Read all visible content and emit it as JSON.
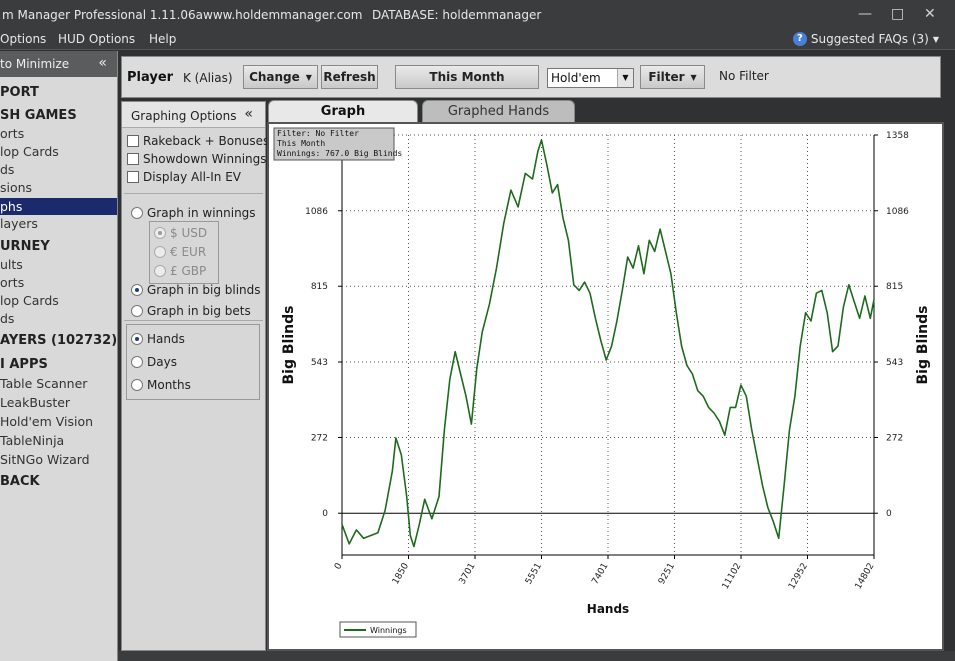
{
  "titlebar": {
    "title": "m Manager Professional 1.11.06a",
    "url": "www.holdemmanager.com",
    "database": "DATABASE: holdemmanager"
  },
  "menubar": {
    "items": [
      "Options",
      "HUD Options",
      "Help"
    ],
    "faq": "Suggested FAQs (3)"
  },
  "sidebar": {
    "header": "to Minimize",
    "items": [
      {
        "label": "PORT",
        "kind": "heading"
      },
      {
        "label": "SH GAMES",
        "kind": "heading"
      },
      {
        "label": "orts",
        "kind": "item"
      },
      {
        "label": "lop Cards",
        "kind": "item"
      },
      {
        "label": "ds",
        "kind": "item"
      },
      {
        "label": "sions",
        "kind": "item"
      },
      {
        "label": "phs",
        "kind": "selected"
      },
      {
        "label": "layers",
        "kind": "item"
      },
      {
        "label": "URNEY",
        "kind": "heading"
      },
      {
        "label": "ults",
        "kind": "item"
      },
      {
        "label": "orts",
        "kind": "item"
      },
      {
        "label": "lop Cards",
        "kind": "item"
      },
      {
        "label": "ds",
        "kind": "item"
      },
      {
        "label": "AYERS (102732)",
        "kind": "heading"
      },
      {
        "label": "I APPS",
        "kind": "heading"
      },
      {
        "label": "Table Scanner",
        "kind": "item"
      },
      {
        "label": "LeakBuster",
        "kind": "item"
      },
      {
        "label": "Hold'em Vision",
        "kind": "item"
      },
      {
        "label": "TableNinja",
        "kind": "item"
      },
      {
        "label": "SitNGo Wizard",
        "kind": "item"
      },
      {
        "label": "BACK",
        "kind": "heading"
      }
    ]
  },
  "player_bar": {
    "player_label": "Player",
    "player_value": "K (Alias)",
    "change": "Change",
    "refresh": "Refresh",
    "period": "This Month",
    "game": "Hold'em",
    "filter": "Filter",
    "filter_status": "No Filter"
  },
  "graphing_options": {
    "header": "Graphing Options",
    "checkboxes": [
      "Rakeback + Bonuses",
      "Showdown Winnings",
      "Display All-In EV"
    ],
    "graph_in_winnings": "Graph in winnings",
    "currencies": [
      "$ USD",
      "€ EUR",
      "£ GBP"
    ],
    "graph_in_big_blinds": "Graph in big blinds",
    "graph_in_big_bets": "Graph in big bets",
    "x_units": [
      "Hands",
      "Days",
      "Months"
    ]
  },
  "tabs": {
    "graph": "Graph",
    "graphed_hands": "Graphed Hands"
  },
  "chart_data": {
    "type": "line",
    "info_box": [
      "Filter: No Filter",
      "This Month",
      "Winnings: 767.0 Big Blinds"
    ],
    "xlabel": "Hands",
    "ylabel": "Big Blinds",
    "xlim": [
      0,
      14802
    ],
    "ylim": [
      -150,
      1358
    ],
    "x_ticks": [
      0,
      1850,
      3701,
      5551,
      7401,
      9251,
      11102,
      12952,
      14802
    ],
    "y_ticks": [
      0,
      272,
      543,
      815,
      1086,
      1358
    ],
    "legend": "Winnings",
    "grid": true,
    "color": "#1e6b1e",
    "series": [
      {
        "name": "Winnings",
        "x": [
          0,
          200,
          400,
          600,
          800,
          1000,
          1200,
          1400,
          1500,
          1650,
          1800,
          1900,
          2000,
          2150,
          2300,
          2500,
          2700,
          2850,
          3000,
          3150,
          3300,
          3450,
          3600,
          3750,
          3900,
          4100,
          4300,
          4500,
          4700,
          4900,
          5100,
          5300,
          5450,
          5550,
          5700,
          5850,
          6000,
          6150,
          6300,
          6450,
          6600,
          6750,
          6900,
          7050,
          7200,
          7350,
          7500,
          7650,
          7800,
          7950,
          8100,
          8250,
          8400,
          8550,
          8700,
          8850,
          9000,
          9150,
          9300,
          9450,
          9600,
          9750,
          9900,
          10050,
          10200,
          10350,
          10500,
          10650,
          10800,
          10950,
          11100,
          11250,
          11400,
          11550,
          11700,
          11850,
          12000,
          12150,
          12300,
          12450,
          12600,
          12750,
          12900,
          13050,
          13200,
          13350,
          13500,
          13650,
          13800,
          13950,
          14100,
          14250,
          14400,
          14550,
          14700,
          14802
        ],
        "y": [
          -40,
          -110,
          -60,
          -90,
          -80,
          -70,
          10,
          150,
          270,
          210,
          60,
          -80,
          -120,
          -40,
          50,
          -20,
          60,
          300,
          480,
          580,
          500,
          420,
          320,
          520,
          650,
          750,
          880,
          1040,
          1160,
          1100,
          1220,
          1200,
          1300,
          1340,
          1250,
          1150,
          1180,
          1060,
          980,
          820,
          800,
          830,
          790,
          700,
          620,
          550,
          600,
          690,
          800,
          920,
          880,
          960,
          860,
          980,
          940,
          1020,
          940,
          860,
          720,
          600,
          530,
          500,
          440,
          420,
          380,
          360,
          330,
          280,
          380,
          380,
          460,
          420,
          300,
          200,
          100,
          20,
          -30,
          -90,
          100,
          300,
          420,
          600,
          720,
          690,
          790,
          800,
          720,
          580,
          600,
          740,
          820,
          760,
          700,
          780,
          700,
          767
        ]
      }
    ]
  }
}
